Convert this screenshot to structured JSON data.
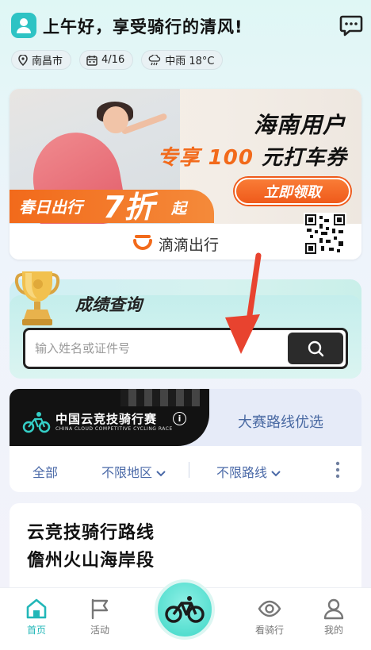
{
  "header": {
    "greeting": "上午好，享受骑行的清风!",
    "chips": [
      {
        "icon": "location-icon",
        "label": "南昌市"
      },
      {
        "icon": "calendar-icon",
        "label": "4/16"
      },
      {
        "icon": "rain-cloud-icon",
        "label": "中雨 18°C"
      }
    ]
  },
  "banner": {
    "title_line1": "海南用户",
    "title_line2_a": "专享",
    "title_line2_b": "100",
    "title_line2_c": "元打车券",
    "claim_button": "立即领取",
    "spring_text": "春日出行",
    "discount": "7折",
    "discount_suffix": "起",
    "brand": "滴滴出行"
  },
  "score": {
    "title": "成绩查询",
    "search_placeholder": "输入姓名或证件号"
  },
  "race": {
    "name": "中国云竞技骑行赛",
    "name_en": "CHINA CLOUD COMPETITIVE CYCLING RACE",
    "route_option": "大赛路线优选",
    "filters": {
      "all": "全部",
      "region": "不限地区",
      "route": "不限路线"
    }
  },
  "route_card": {
    "title_line1": "云竞技骑行路线",
    "title_line2": "儋州火山海岸段"
  },
  "tabbar": {
    "tabs": [
      {
        "label": "首页",
        "active": true
      },
      {
        "label": "活动",
        "active": false
      },
      {
        "label": "看骑行",
        "active": false
      },
      {
        "label": "我的",
        "active": false
      }
    ]
  },
  "colors": {
    "accent": "#22b7b8",
    "orange": "#f26a1b",
    "filter_text": "#4b6aa8"
  }
}
